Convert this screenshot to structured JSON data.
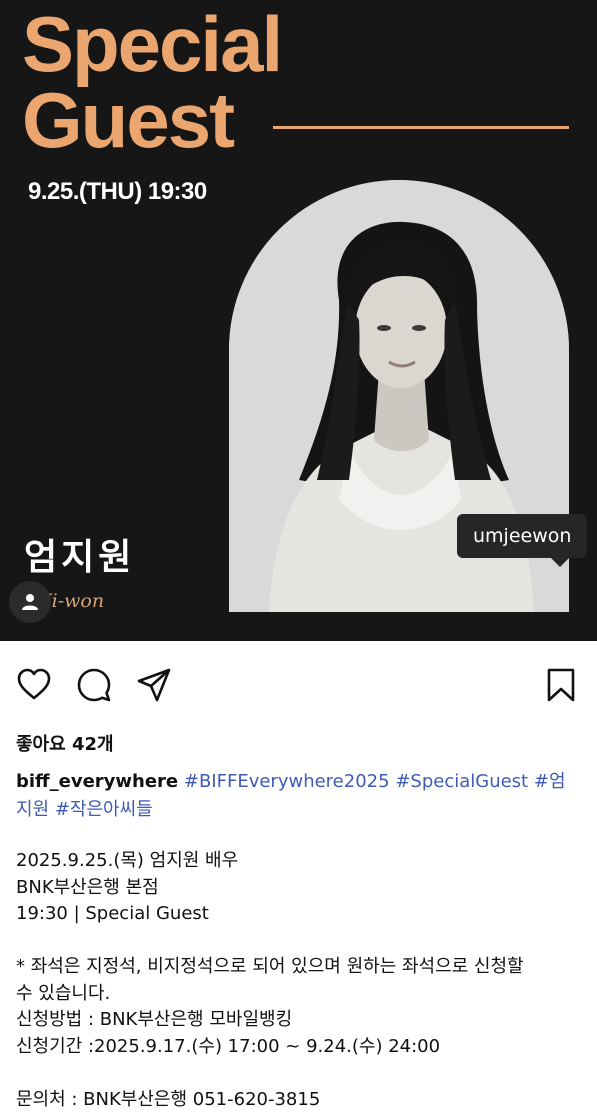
{
  "poster": {
    "headline_line1": "Special",
    "headline_line2": "Guest",
    "event_datetime": "9.25.(THU) 19:30",
    "guest_name_kr": "엄지원",
    "guest_name_sign": "Ji-won",
    "accent_color": "#eba56f"
  },
  "photo_tag": {
    "username": "umjeewon"
  },
  "icons": {
    "like": "heart-icon",
    "comment": "comment-icon",
    "share": "send-icon",
    "save": "bookmark-icon",
    "tag": "person-icon"
  },
  "post": {
    "likes_text": "좋아요 42개",
    "author": "biff_everywhere",
    "hashtags": [
      "#BIFFEverywhere2025",
      "#SpecialGuest",
      "#엄지원",
      "#작은아씨들"
    ],
    "body_lines": [
      "2025.9.25.(목) 엄지원 배우",
      "BNK부산은행 본점",
      "19:30 | Special Guest",
      "",
      "* 좌석은 지정석, 비지정석으로 되어 있으며 원하는 좌석으로 신청할",
      "수 있습니다.",
      "신청방법 : BNK부산은행 모바일뱅킹",
      "신청기간 :2025.9.17.(수) 17:00 ~ 9.24.(수) 24:00",
      "",
      "문의처 : BNK부산은행 051-620-3815"
    ]
  }
}
